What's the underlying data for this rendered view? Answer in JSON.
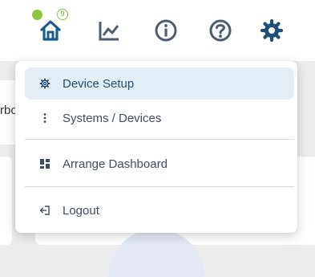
{
  "header": {
    "notification_count": "9",
    "icons": [
      "home-icon",
      "chart-icon",
      "info-icon",
      "help-icon",
      "gear-icon"
    ]
  },
  "background": {
    "left_card_text": "rbo"
  },
  "menu": {
    "items": [
      {
        "label": "Device Setup",
        "icon": "gear-icon",
        "active": true
      },
      {
        "label": "Systems / Devices",
        "icon": "vertical-dots-icon"
      },
      {
        "label": "Arrange Dashboard",
        "icon": "grid-icon"
      },
      {
        "label": "Logout",
        "icon": "logout-icon"
      }
    ]
  },
  "colors": {
    "icon_dark": "#4a5e70",
    "accent_blue": "#1f5c8e",
    "status_green": "#8cc63f",
    "active_bg": "#e3edf6"
  }
}
